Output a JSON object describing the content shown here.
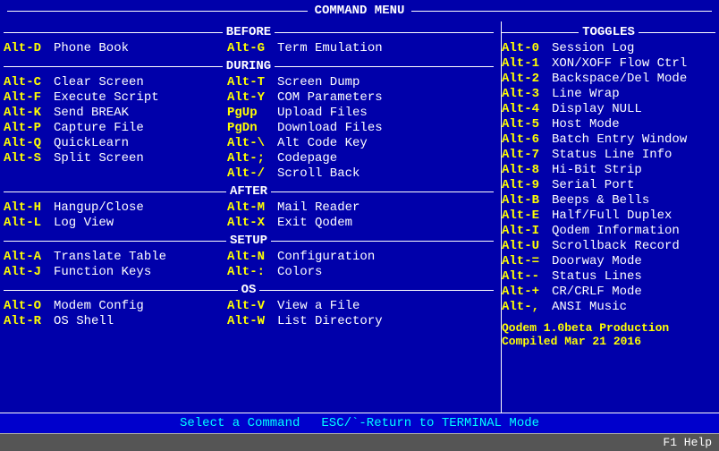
{
  "title": "COMMAND MENU",
  "sections": {
    "before": {
      "label": "BEFORE",
      "items": [
        {
          "key": "Alt-D",
          "label": "Phone Book",
          "key2": "Alt-G",
          "label2": "Term Emulation"
        }
      ]
    },
    "during": {
      "label": "DURING",
      "items": [
        {
          "key": "Alt-C",
          "label": "Clear Screen",
          "key2": "Alt-T",
          "label2": "Screen Dump"
        },
        {
          "key": "Alt-F",
          "label": "Execute Script",
          "key2": "Alt-Y",
          "label2": "COM Parameters"
        },
        {
          "key": "Alt-K",
          "label": "Send BREAK",
          "key2": "PgUp",
          "label2": "Upload Files"
        },
        {
          "key": "Alt-P",
          "label": "Capture File",
          "key2": "PgDn",
          "label2": "Download Files"
        },
        {
          "key": "Alt-Q",
          "label": "QuickLearn",
          "key2": "Alt-\\",
          "label2": "Alt Code Key"
        },
        {
          "key": "Alt-S",
          "label": "Split Screen",
          "key2": "Alt-;",
          "label2": "Codepage"
        },
        {
          "key": "",
          "label": "",
          "key2": "Alt-/",
          "label2": "Scroll Back"
        }
      ]
    },
    "after": {
      "label": "AFTER",
      "items": [
        {
          "key": "Alt-H",
          "label": "Hangup/Close",
          "key2": "Alt-M",
          "label2": "Mail Reader"
        },
        {
          "key": "Alt-L",
          "label": "Log View",
          "key2": "Alt-X",
          "label2": "Exit Qodem"
        }
      ]
    },
    "setup": {
      "label": "SETUP",
      "items": [
        {
          "key": "Alt-A",
          "label": "Translate Table",
          "key2": "Alt-N",
          "label2": "Configuration"
        },
        {
          "key": "Alt-J",
          "label": "Function Keys",
          "key2": "Alt-:",
          "label2": "Colors"
        }
      ]
    },
    "os": {
      "label": "OS",
      "items": [
        {
          "key": "Alt-O",
          "label": "Modem Config",
          "key2": "Alt-V",
          "label2": "View a File"
        },
        {
          "key": "Alt-R",
          "label": "OS Shell",
          "key2": "Alt-W",
          "label2": "List Directory"
        }
      ]
    }
  },
  "toggles": {
    "label": "TOGGLES",
    "items": [
      {
        "key": "Alt-0",
        "label": "Session Log"
      },
      {
        "key": "Alt-1",
        "label": "XON/XOFF Flow Ctrl"
      },
      {
        "key": "Alt-2",
        "label": "Backspace/Del Mode"
      },
      {
        "key": "Alt-3",
        "label": "Line Wrap"
      },
      {
        "key": "Alt-4",
        "label": "Display NULL"
      },
      {
        "key": "Alt-5",
        "label": "Host Mode"
      },
      {
        "key": "Alt-6",
        "label": "Batch Entry Window"
      },
      {
        "key": "Alt-7",
        "label": "Status Line Info"
      },
      {
        "key": "Alt-8",
        "label": "Hi-Bit Strip"
      },
      {
        "key": "Alt-9",
        "label": "Serial Port"
      },
      {
        "key": "Alt-B",
        "label": "Beeps & Bells"
      },
      {
        "key": "Alt-E",
        "label": "Half/Full Duplex"
      },
      {
        "key": "Alt-I",
        "label": "Qodem Information"
      },
      {
        "key": "Alt-U",
        "label": "Scrollback Record"
      },
      {
        "key": "Alt-=",
        "label": "Doorway Mode"
      },
      {
        "key": "Alt--",
        "label": "Status Lines"
      },
      {
        "key": "Alt-+",
        "label": "CR/CRLF Mode"
      },
      {
        "key": "Alt-,",
        "label": "ANSI Music"
      }
    ]
  },
  "version": {
    "line1": "Qodem 1.0beta Production",
    "line2": "Compiled Mar 21 2016"
  },
  "bottom": {
    "select": "Select a Command",
    "escape": "ESC/`-Return to TERMINAL Mode",
    "f1": "F1 Help"
  }
}
